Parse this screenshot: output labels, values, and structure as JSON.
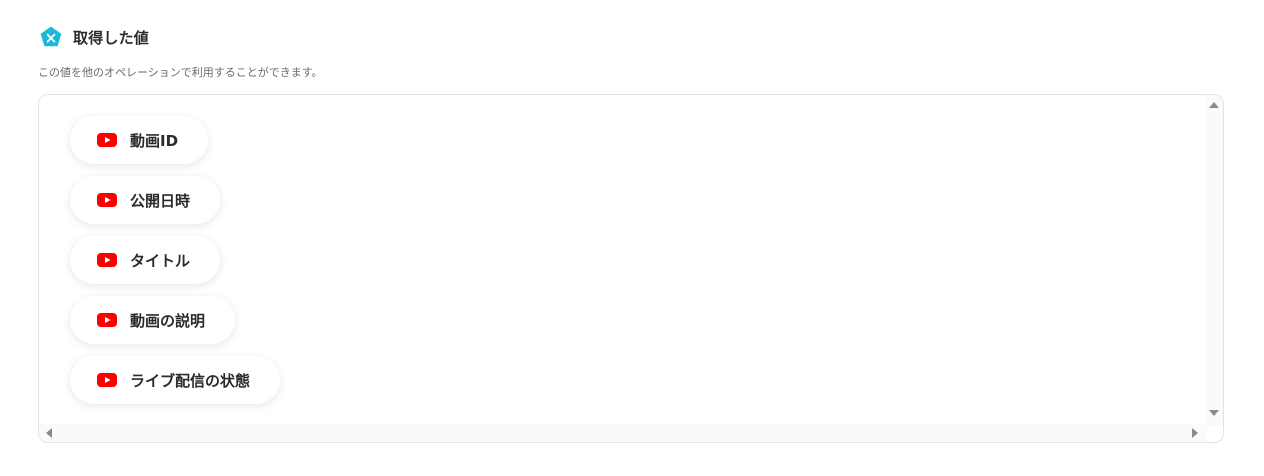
{
  "header": {
    "icon": "variable-pentagon-icon",
    "icon_color": "#1bb9d8",
    "title": "取得した値"
  },
  "description": "この値を他のオペレーションで利用することができます。",
  "values_list": {
    "item_icon": "youtube-icon",
    "item_icon_color": "#ff0000",
    "items": [
      {
        "label": "動画ID"
      },
      {
        "label": "公開日時"
      },
      {
        "label": "タイトル"
      },
      {
        "label": "動画の説明"
      },
      {
        "label": "ライブ配信の状態"
      }
    ]
  },
  "scrollbars": {
    "vertical": true,
    "horizontal": true
  }
}
